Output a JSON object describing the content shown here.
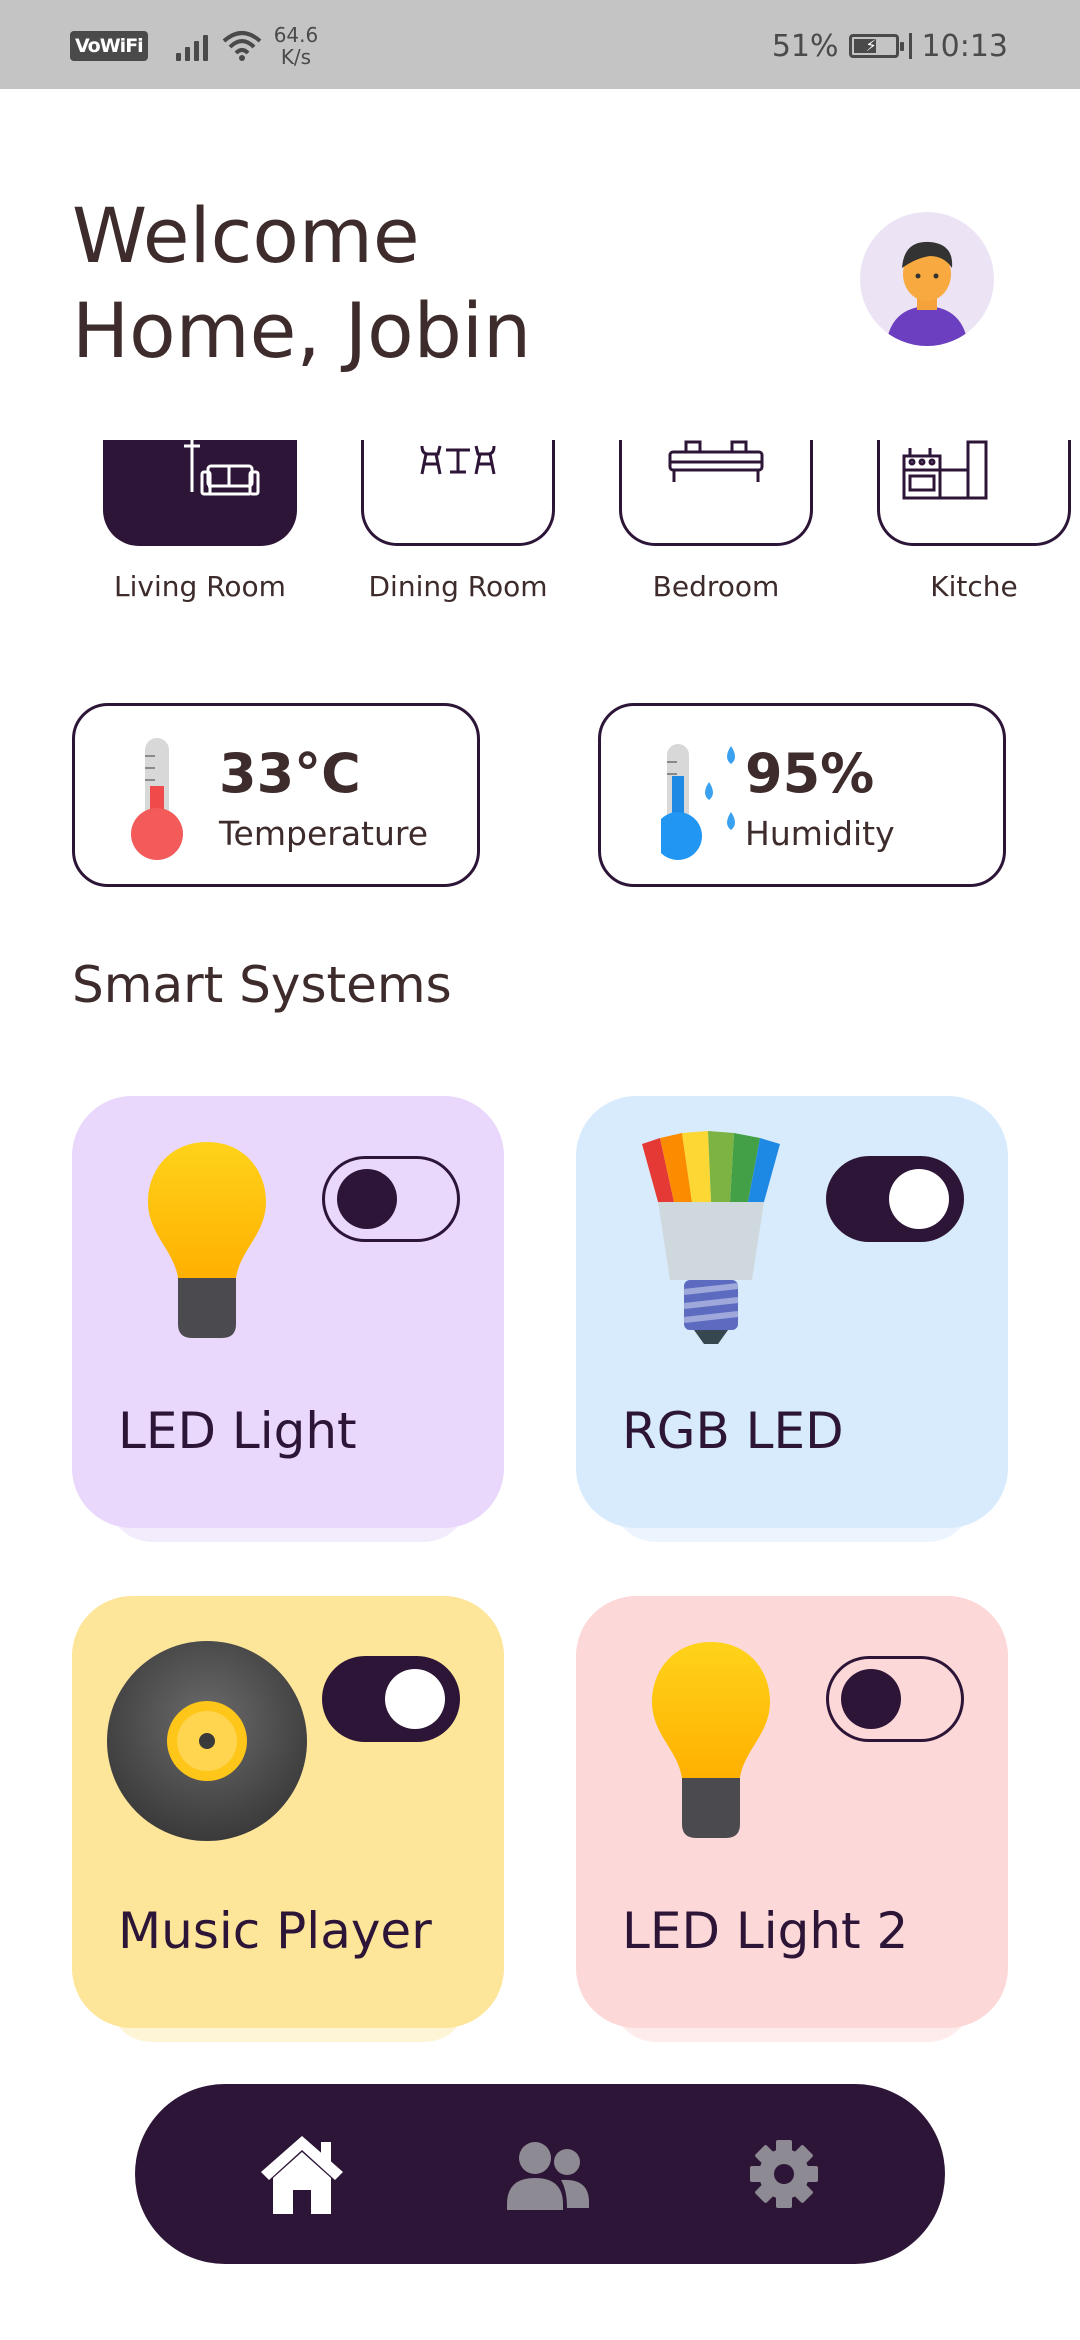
{
  "status_bar": {
    "network_label": "VoWiFi",
    "speed_value": "64.6",
    "speed_unit": "K/s",
    "battery": "51%",
    "time": "10:13"
  },
  "header": {
    "greeting_line1": "Welcome",
    "greeting_line2": "Home, Jobin",
    "avatar_icon": "user-avatar-icon"
  },
  "rooms": [
    {
      "label": "Living Room",
      "icon": "sofa-icon",
      "active": true
    },
    {
      "label": "Dining Room",
      "icon": "dining-table-icon",
      "active": false
    },
    {
      "label": "Bedroom",
      "icon": "bed-icon",
      "active": false
    },
    {
      "label": "Kitche",
      "icon": "kitchen-icon",
      "active": false
    }
  ],
  "climate": {
    "temperature": {
      "value": "33°C",
      "label": "Temperature",
      "icon": "thermometer-hot-icon"
    },
    "humidity": {
      "value": "95%",
      "label": "Humidity",
      "icon": "thermometer-humidity-icon"
    }
  },
  "section_title": "Smart Systems",
  "devices": [
    {
      "name": "LED Light",
      "icon": "light-bulb-icon",
      "on": false,
      "bg": "#e9d8fb"
    },
    {
      "name": "RGB LED",
      "icon": "rgb-bulb-icon",
      "on": true,
      "bg": "#d8ebfc"
    },
    {
      "name": "Music Player",
      "icon": "vinyl-record-icon",
      "on": true,
      "bg": "#fde59a"
    },
    {
      "name": "LED Light 2",
      "icon": "light-bulb-icon",
      "on": false,
      "bg": "#fdd8d8"
    }
  ],
  "bottom_nav": [
    {
      "icon": "home-icon",
      "active": true
    },
    {
      "icon": "users-icon",
      "active": false
    },
    {
      "icon": "gear-icon",
      "active": false
    }
  ],
  "colors": {
    "primary": "#2d1537",
    "text": "#3e2b2b",
    "status_bar": "#c4c4c4"
  }
}
